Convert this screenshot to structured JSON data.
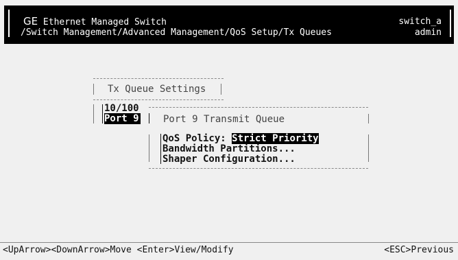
{
  "header": {
    "brand": "GE",
    "title_rest": " Ethernet Managed Switch",
    "path": "/Switch Management/Advanced Management/QoS Setup/Tx Queues",
    "hostname": "switch_a",
    "user": "admin"
  },
  "settings_box": {
    "title": "Tx Queue Settings"
  },
  "port_list": {
    "items": [
      {
        "label": "10/100"
      },
      {
        "label": "Port  9",
        "selected": true
      }
    ]
  },
  "queue_panel": {
    "title": "Port 9 Transmit Queue",
    "qos_label": "QoS Policy: ",
    "qos_value": "Strict Priority",
    "menu": [
      {
        "label": "Bandwidth Partitions..."
      },
      {
        "label": "Shaper Configuration..."
      }
    ]
  },
  "footer": {
    "keys_left": "<UpArrow><DownArrow>Move <Enter>View/Modify",
    "keys_right": "<ESC>Previous"
  }
}
